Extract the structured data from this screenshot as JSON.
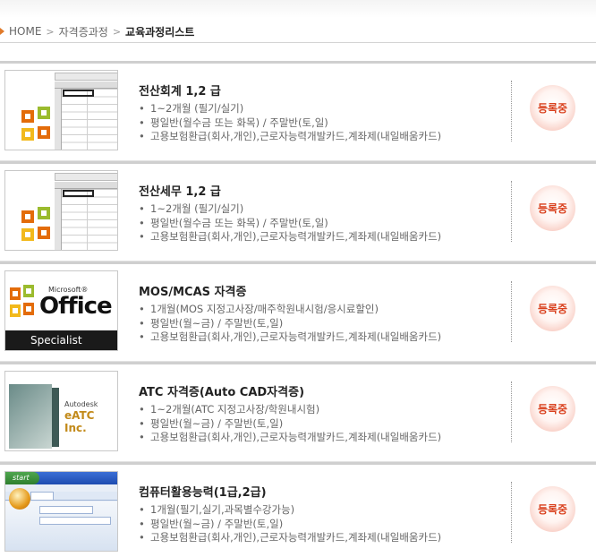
{
  "breadcrumb": {
    "home": "HOME",
    "separator": ">",
    "level1": "자격증과정",
    "current": "교육과정리스트"
  },
  "colors": {
    "accent": "#e07a2a",
    "badge_text": "#d9411e",
    "title_text": "#222222",
    "detail_text": "#666666"
  },
  "bullet_glyph": "•",
  "courses": [
    {
      "title": "전산회계 1,2 급",
      "thumbnail": "spreadsheet-icon",
      "details": [
        "1~2개월 (필기/실기)",
        "평일반(월수금 또는 화목) / 주말반(토,일)",
        "고용보험환급(회사,개인),근로자능력개발카드,계좌제(내일배움카드)"
      ],
      "status": "등록중"
    },
    {
      "title": "전산세무 1,2 급",
      "thumbnail": "spreadsheet-icon",
      "details": [
        "1~2개월 (필기/실기)",
        "평일반(월수금 또는 화목) / 주말반(토,일)",
        "고용보험환급(회사,개인),근로자능력개발카드,계좌제(내일배움카드)"
      ],
      "status": "등록중"
    },
    {
      "title": "MOS/MCAS 자격증",
      "thumbnail": "office-specialist-logo",
      "thumb_text": {
        "ms": "Microsoft®",
        "office": "Office",
        "specialist": "Specialist"
      },
      "details": [
        "1개월(MOS 지정고사장/매주학원내시험/응시료할인)",
        "평일반(월~금) / 주말반(토,일)",
        "고용보험환급(회사,개인),근로자능력개발카드,계좌제(내일배움카드)"
      ],
      "status": "등록중"
    },
    {
      "title": "ATC 자격증(Auto CAD자격증)",
      "thumbnail": "autocad-box",
      "thumb_text": {
        "company": "Autodesk",
        "brand": "eATC Inc."
      },
      "details": [
        "1~2개월(ATC 지정고사장/학원내시험)",
        "평일반(월~금) / 주말반(토,일)",
        "고용보험환급(회사,개인),근로자능력개발카드,계좌제(내일배움카드)"
      ],
      "status": "등록중"
    },
    {
      "title": "컴퓨터활용능력(1급,2급)",
      "thumbnail": "windows-word-screenshot",
      "thumb_text": {
        "start": "start"
      },
      "details": [
        "1개월(필기,실기,과목별수강가능)",
        "평일반(월~금) / 주말반(토,일)",
        "고용보험환급(회사,개인),근로자능력개발카드,계좌제(내일배움카드)"
      ],
      "status": "등록중"
    }
  ]
}
